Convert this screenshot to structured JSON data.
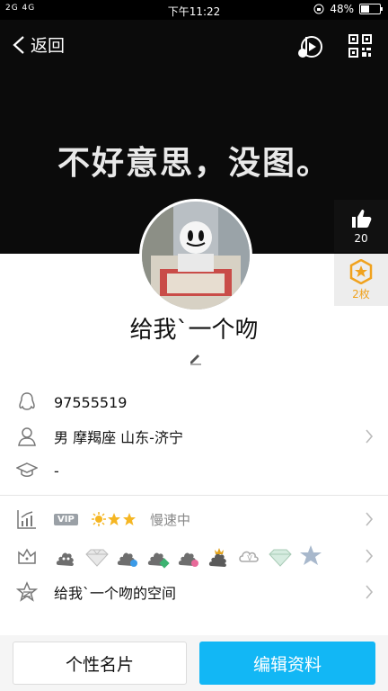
{
  "status_bar": {
    "signal_text": "2G 4G",
    "time": "下午11:22",
    "battery_percent": "48%",
    "battery_level": 0.48
  },
  "header": {
    "back_label": "返回",
    "banner_text": "不好意思，没图。"
  },
  "side": {
    "like_count": "20",
    "medal_count": "2枚"
  },
  "profile": {
    "nickname": "给我`一个吻"
  },
  "info": {
    "qq_number": "97555519",
    "basic": "男  摩羯座  山东-济宁",
    "education": "-",
    "vip_label": "VIP",
    "speed_status": "慢速中",
    "space_label": "给我`一个吻的空间"
  },
  "badges": [
    "poop-badge",
    "diamond-badge",
    "poop-blue-badge",
    "poop-green-badge",
    "poop-pink-badge",
    "poop-crown-badge",
    "cloud-v-badge",
    "diamond-green-badge",
    "star-blue-badge"
  ],
  "bottom": {
    "card_button": "个性名片",
    "edit_button": "编辑资料"
  },
  "colors": {
    "accent": "#12b7f5",
    "banner_bg": "#0b0b0b",
    "medal": "#f0a21e"
  }
}
